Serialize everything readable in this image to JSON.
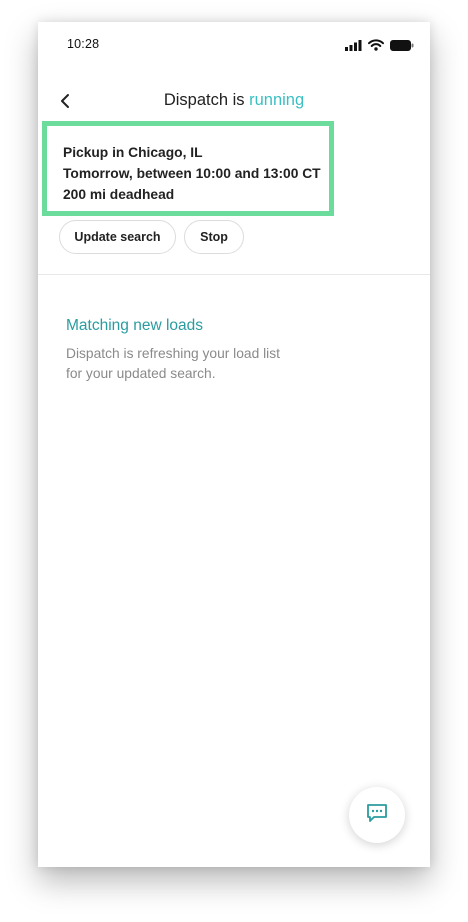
{
  "status_bar": {
    "time": "10:28"
  },
  "header": {
    "title_prefix": "Dispatch is ",
    "title_status": "running"
  },
  "search_summary": {
    "pickup": "Pickup in Chicago, IL",
    "timeframe": "Tomorrow, between 10:00 and 13:00 CT",
    "deadhead": "200 mi deadhead"
  },
  "actions": {
    "update_search_label": "Update search",
    "stop_label": "Stop"
  },
  "status_section": {
    "title": "Matching new loads",
    "description": "Dispatch is refreshing your load list for your updated search."
  },
  "icons": {
    "back": "chevron-left-icon",
    "chat": "chat-bubble-icon",
    "signal": "signal-icon",
    "wifi": "wifi-icon",
    "battery": "battery-icon"
  },
  "colors": {
    "accent": "#3bbfc2",
    "accent_dark": "#2a9c9f",
    "highlight_border": "#6cdc9c"
  }
}
